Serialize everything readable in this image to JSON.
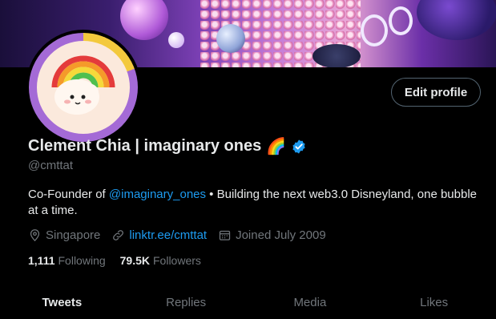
{
  "profile": {
    "name": "Clement Chia | imaginary ones",
    "name_emoji": "🌈",
    "handle": "@cmttat",
    "bio_prefix": "Co-Founder of ",
    "bio_mention": "@imaginary_ones",
    "bio_suffix": " • Building the next web3.0 Disneyland, one bubble at a time.",
    "location": "Singapore",
    "website": "linktr.ee/cmttat",
    "joined": "Joined July 2009"
  },
  "stats": {
    "following_count": "1,111",
    "following_label": "Following",
    "followers_count": "79.5K",
    "followers_label": "Followers"
  },
  "actions": {
    "edit_profile": "Edit profile"
  },
  "tabs": [
    {
      "label": "Tweets",
      "active": true
    },
    {
      "label": "Replies",
      "active": false
    },
    {
      "label": "Media",
      "active": false
    },
    {
      "label": "Likes",
      "active": false
    }
  ],
  "colors": {
    "accent": "#1d9bf0",
    "muted": "#71767b",
    "text": "#e7e9ea",
    "background": "#000000"
  }
}
